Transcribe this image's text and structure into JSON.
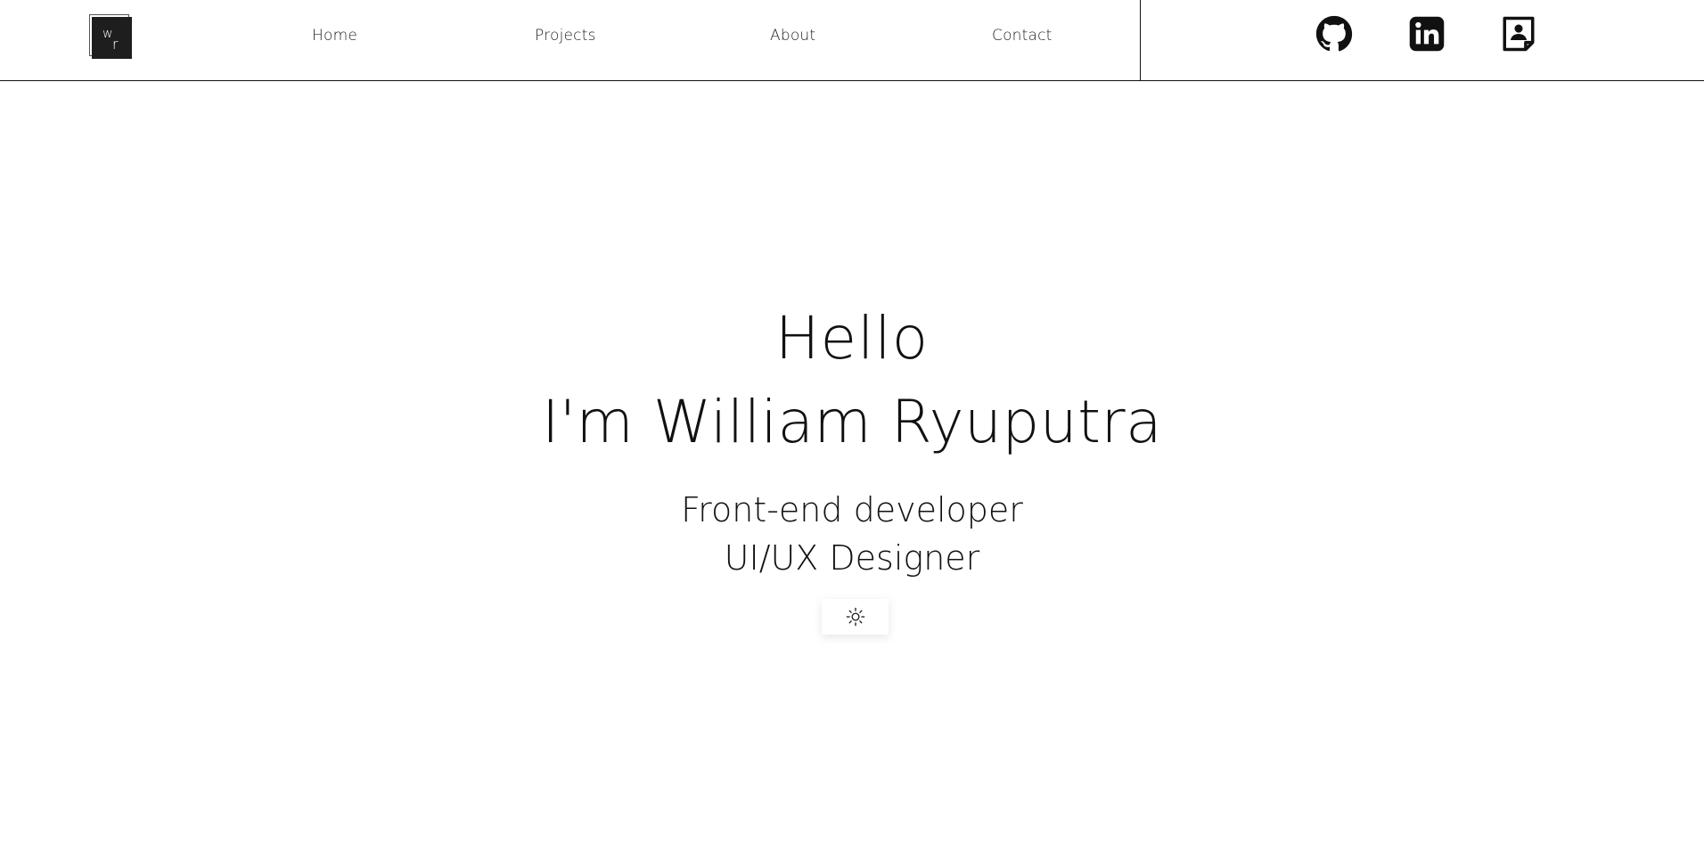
{
  "logo": {
    "letters": [
      "w",
      "r"
    ]
  },
  "nav": {
    "links": [
      {
        "label": "Home"
      },
      {
        "label": "Projects"
      },
      {
        "label": "About"
      },
      {
        "label": "Contact"
      }
    ]
  },
  "social": [
    {
      "icon": "github-icon"
    },
    {
      "icon": "linkedin-icon"
    },
    {
      "icon": "contact-card-icon"
    }
  ],
  "hero": {
    "greeting": "Hello",
    "name": "I'm William Ryuputra",
    "roles": [
      "Front-end developer",
      "UI/UX Designer"
    ]
  },
  "theme_toggle": {
    "icon": "sun-icon"
  },
  "colors": {
    "text": "#111111",
    "background": "#ffffff",
    "logo_fill": "#1e1e1e"
  }
}
